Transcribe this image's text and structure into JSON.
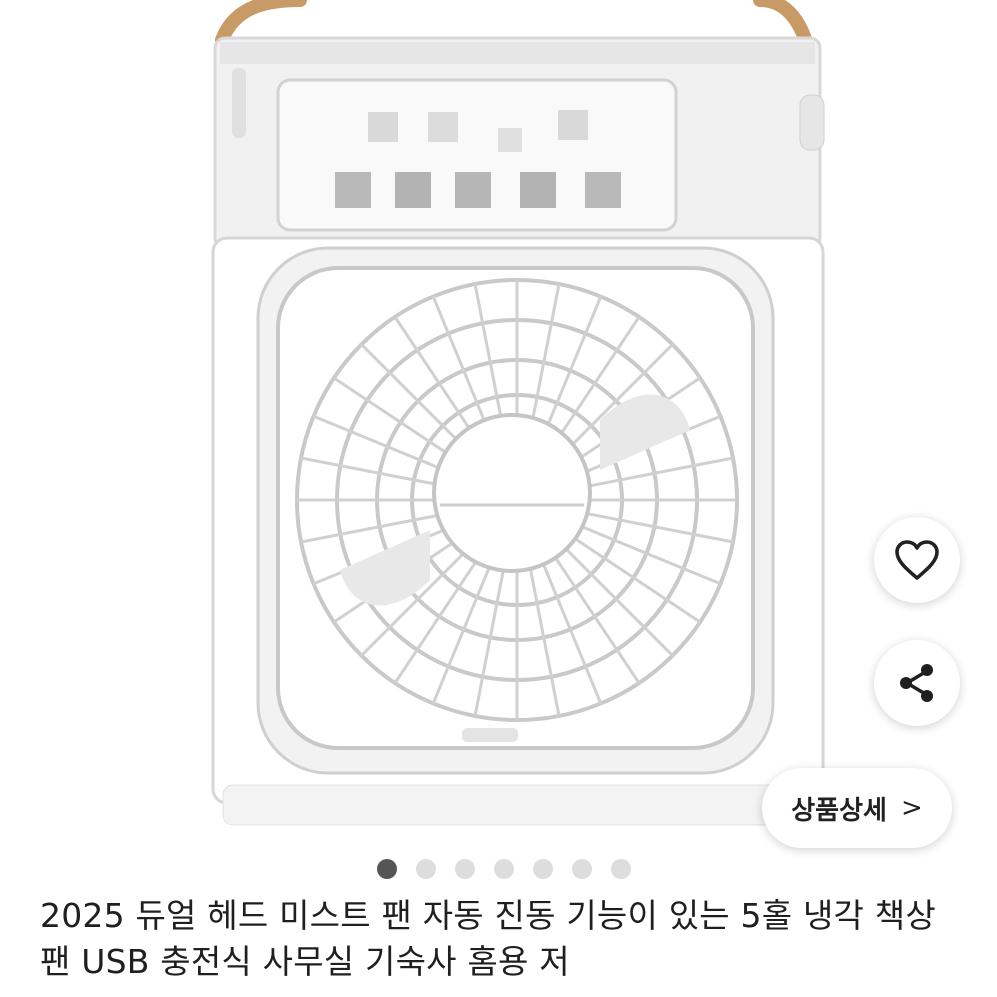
{
  "product": {
    "title": "2025 듀얼 헤드 미스트 팬 자동 진동 기능이 있는 5홀 냉각 책상 팬 USB 충전식 사무실 기숙사 홈용 저",
    "image_alt": "white mist cooling fan",
    "image_count": 7,
    "active_image_index": 0
  },
  "actions": {
    "like_icon": "heart-outline-icon",
    "share_icon": "share-icon",
    "detail_label": "상품상세",
    "detail_chevron": ">"
  },
  "colors": {
    "background": "#ffffff",
    "dot_active": "#555555",
    "dot_inactive": "#dddddd",
    "text": "#1f1f1f"
  }
}
